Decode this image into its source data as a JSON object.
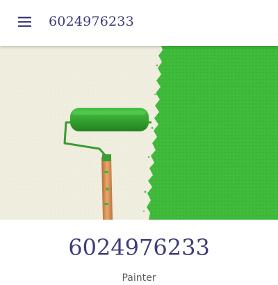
{
  "header": {
    "menu_icon": "hamburger-menu-icon",
    "title": "6024976233"
  },
  "hero": {
    "image_description_icon": "paint-roller-image",
    "colors": {
      "wall": "#f1efe1",
      "paint": "#3fba3a",
      "roller": "#36a632",
      "handle": "#d98a4a"
    }
  },
  "main": {
    "business_name": "6024976233",
    "category": "Painter"
  },
  "colors": {
    "accent": "#3d3c7a"
  }
}
